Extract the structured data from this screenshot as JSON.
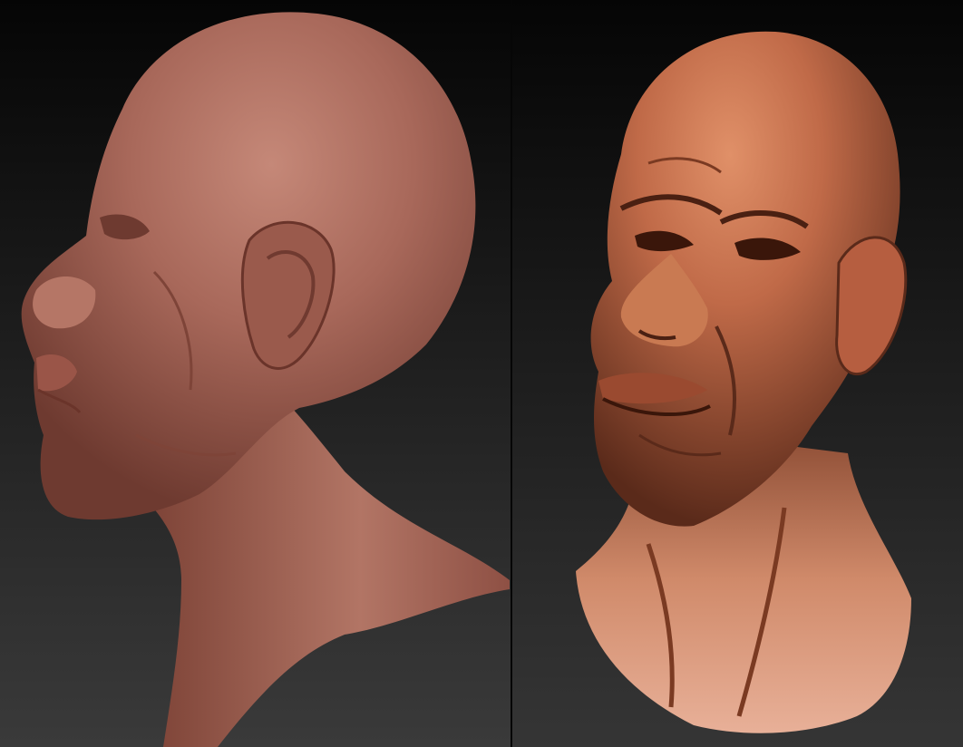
{
  "scene": {
    "views": [
      {
        "name": "side-profile-clay-sculpt",
        "material_color": "#a8685a",
        "shadow_color": "#6e3a30"
      },
      {
        "name": "three-quarter-textured-sculpt",
        "material_color": "#c06a48",
        "shadow_color": "#5a2a1a"
      }
    ],
    "background_colors": [
      "#050505",
      "#3a3a3a"
    ]
  }
}
